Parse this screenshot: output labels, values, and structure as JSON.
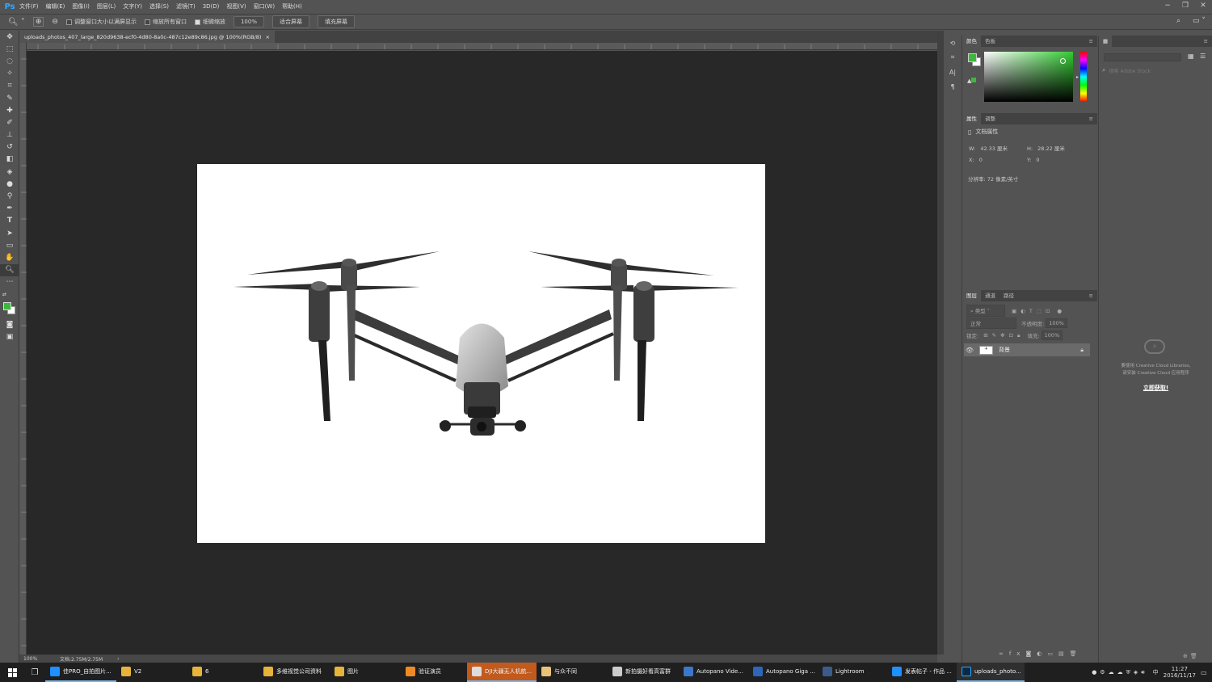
{
  "menubar": {
    "logo": "Ps",
    "items": [
      "文件(F)",
      "编辑(E)",
      "图像(I)",
      "图层(L)",
      "文字(Y)",
      "选择(S)",
      "滤镜(T)",
      "3D(D)",
      "视图(V)",
      "窗口(W)",
      "帮助(H)"
    ]
  },
  "options": {
    "resize_windows": "调整窗口大小以满屏显示",
    "zoom_all": "缩放所有窗口",
    "scrubby_zoom": "细微缩放",
    "zoom_value": "100%",
    "fit_screen": "适合屏幕",
    "fill_screen": "填充屏幕"
  },
  "document": {
    "tab_label": "uploads_photos_407_large_820d9638-ecf0-4d80-8a0c-487c12e89c86.jpg @ 100%(RGB/8)",
    "close": "×"
  },
  "status": {
    "zoom": "100%",
    "doc_size": "文档:2.75M/2.75M"
  },
  "color_panel": {
    "tab_color": "颜色",
    "tab_swatches": "色板",
    "fg": "#3cb83c",
    "bg": "#ffffff",
    "hue": "#33cc33"
  },
  "properties": {
    "tab_props": "属性",
    "tab_adjust": "调整",
    "title": "文档属性",
    "w_label": "W:",
    "w_value": "42.33 厘米",
    "h_label": "H:",
    "h_value": "28.22 厘米",
    "x_label": "X:",
    "x_value": "0",
    "y_label": "Y:",
    "y_value": "0",
    "resolution": "分辨率: 72 像素/英寸"
  },
  "layers": {
    "tab_layers": "图层",
    "tab_channels": "通道",
    "tab_paths": "路径",
    "filter_kind": "类型",
    "blend_mode": "正常",
    "opacity_label": "不透明度:",
    "opacity_value": "100%",
    "lock_label": "锁定:",
    "fill_label": "填充:",
    "fill_value": "100%",
    "layer_name": "背景"
  },
  "cc_panel": {
    "search_placeholder": "搜索 Adobe Stock",
    "msg1": "要使用 Creative Cloud Libraries,",
    "msg2": "请安装 Creative Cloud 应用程序",
    "link": "立即获取!"
  },
  "taskbar": {
    "items": [
      {
        "label": "佳PRO_自拍图片...",
        "color": "#1e90ff",
        "open": true,
        "hi": false
      },
      {
        "label": "V2",
        "color": "#e8b33a",
        "open": false,
        "hi": false
      },
      {
        "label": "6",
        "color": "#e8b33a",
        "open": false,
        "hi": false
      },
      {
        "label": "多维视觉公司资料",
        "color": "#e8b33a",
        "open": false,
        "hi": false
      },
      {
        "label": "图片",
        "color": "#e8b33a",
        "open": false,
        "hi": false
      },
      {
        "label": "验证演员",
        "color": "#f08a24",
        "open": false,
        "hi": false
      },
      {
        "label": "DJI大疆无人机航...",
        "color": "#dddddd",
        "open": true,
        "hi": true
      },
      {
        "label": "与众不同",
        "color": "#e8c27a",
        "open": false,
        "hi": false
      },
      {
        "label": "新拍摄好看高富群",
        "color": "#cccccc",
        "open": false,
        "hi": false
      },
      {
        "label": "Autopano Vide...",
        "color": "#3a78c8",
        "open": false,
        "hi": false
      },
      {
        "label": "Autopano Giga ...",
        "color": "#2e66b8",
        "open": false,
        "hi": false
      },
      {
        "label": "Lightroom",
        "color": "#3a5c8c",
        "open": false,
        "hi": false
      },
      {
        "label": "发表帖子 - 作品 ...",
        "color": "#1e90ff",
        "open": false,
        "hi": false
      },
      {
        "label": "uploads_photo...",
        "color": "#31a8ff",
        "open": true,
        "hi": false
      }
    ],
    "time": "11:27",
    "date": "2016/11/17",
    "ime": "中"
  }
}
